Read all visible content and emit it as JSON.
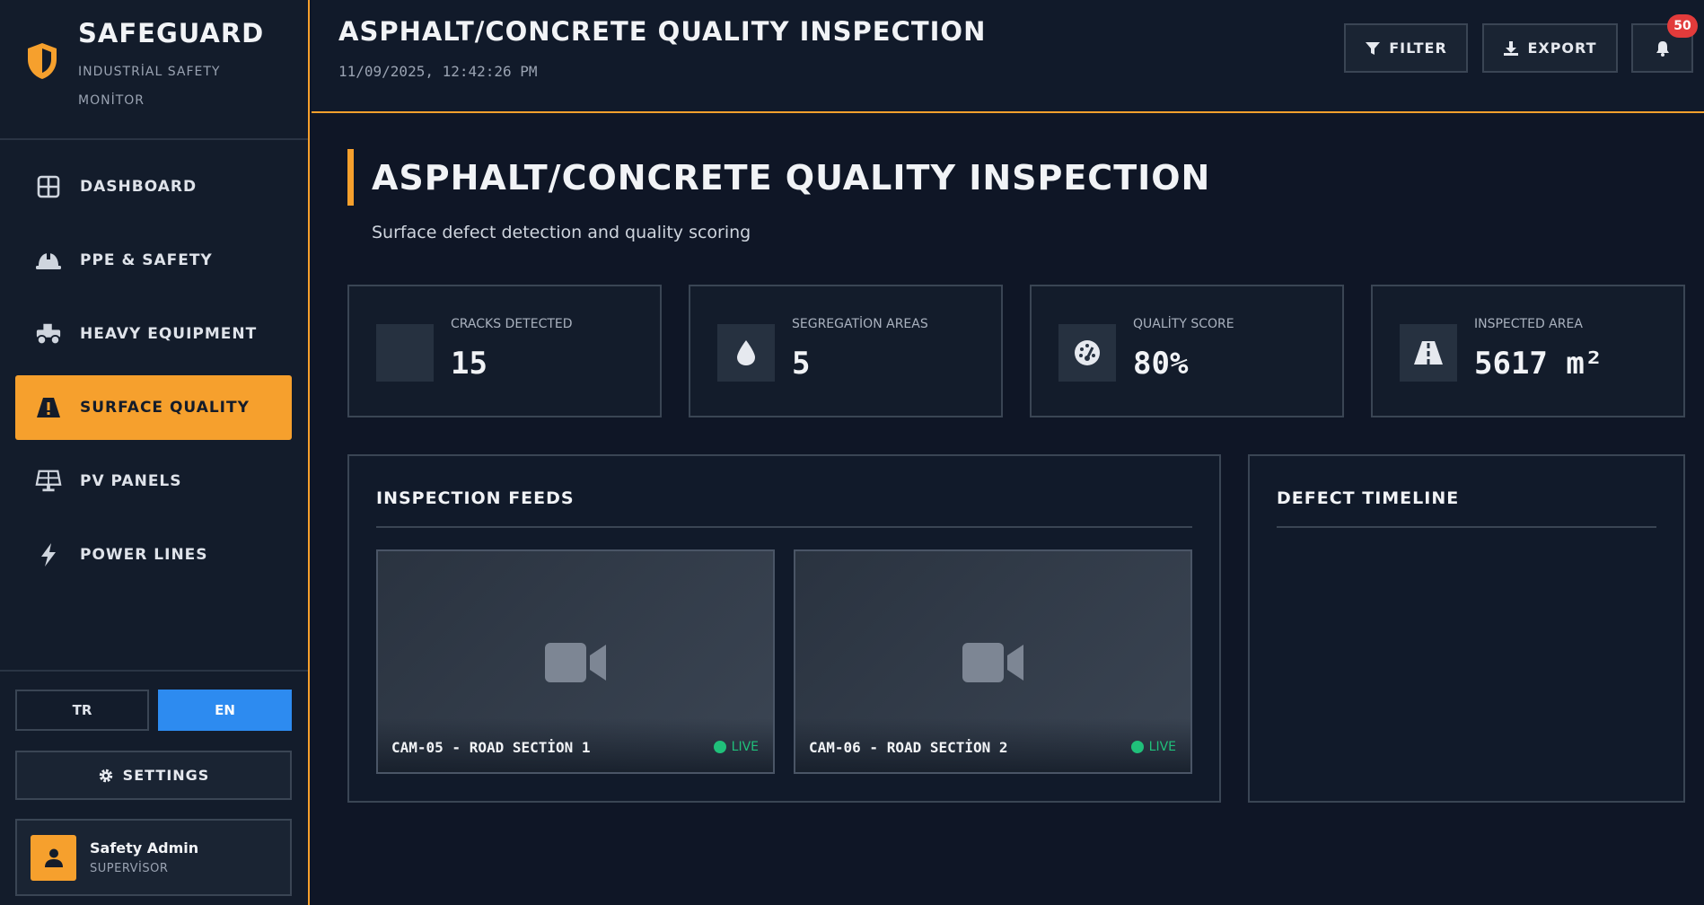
{
  "brand": {
    "title": "SAFEGUARD",
    "subtitle": "INDUSTRİAL SAFETY MONİTOR",
    "icon": "shield-icon",
    "accent": "#f6a02d"
  },
  "sidebar": {
    "items": [
      {
        "label": "DASHBOARD",
        "icon": "grid-icon",
        "active": false
      },
      {
        "label": "PPE & SAFETY",
        "icon": "hard-hat-icon",
        "active": false
      },
      {
        "label": "HEAVY EQUIPMENT",
        "icon": "truck-icon",
        "active": false
      },
      {
        "label": "SURFACE QUALITY",
        "icon": "road-warning-icon",
        "active": true
      },
      {
        "label": "PV PANELS",
        "icon": "solar-panel-icon",
        "active": false
      },
      {
        "label": "POWER LINES",
        "icon": "bolt-icon",
        "active": false
      }
    ],
    "languages": [
      {
        "label": "TR",
        "active": false
      },
      {
        "label": "EN",
        "active": true
      }
    ],
    "settings_label": "SETTINGS",
    "user": {
      "name": "Safety Admin",
      "role": "SUPERVİSOR"
    }
  },
  "header": {
    "title": "ASPHALT/CONCRETE QUALITY INSPECTION",
    "datetime": "11/09/2025, 12:42:26 PM",
    "filter_label": "FILTER",
    "export_label": "EXPORT",
    "notification_count": "50"
  },
  "page": {
    "title": "ASPHALT/CONCRETE QUALITY INSPECTION",
    "subtitle": "Surface defect detection and quality scoring"
  },
  "stats": [
    {
      "label": "CRACKS DETECTED",
      "value": "15",
      "icon": "none"
    },
    {
      "label": "SEGREGATİON AREAS",
      "value": "5",
      "icon": "droplet-icon"
    },
    {
      "label": "QUALİTY SCORE",
      "value": "80%",
      "icon": "gauge-icon"
    },
    {
      "label": "INSPECTED AREA",
      "value": "5617 m²",
      "icon": "road-icon"
    }
  ],
  "feeds_panel": {
    "title": "INSPECTION FEEDS",
    "feeds": [
      {
        "name": "CAM-05 - ROAD SECTİON 1",
        "status": "LIVE"
      },
      {
        "name": "CAM-06 - ROAD SECTİON 2",
        "status": "LIVE"
      }
    ]
  },
  "timeline_panel": {
    "title": "DEFECT TIMELINE"
  },
  "colors": {
    "background": "#0f1626",
    "sidebar": "#131c2b",
    "accent": "#f6a02d",
    "language_active": "#2d8bf0",
    "live": "#20c07a",
    "badge": "#e23b3b"
  }
}
